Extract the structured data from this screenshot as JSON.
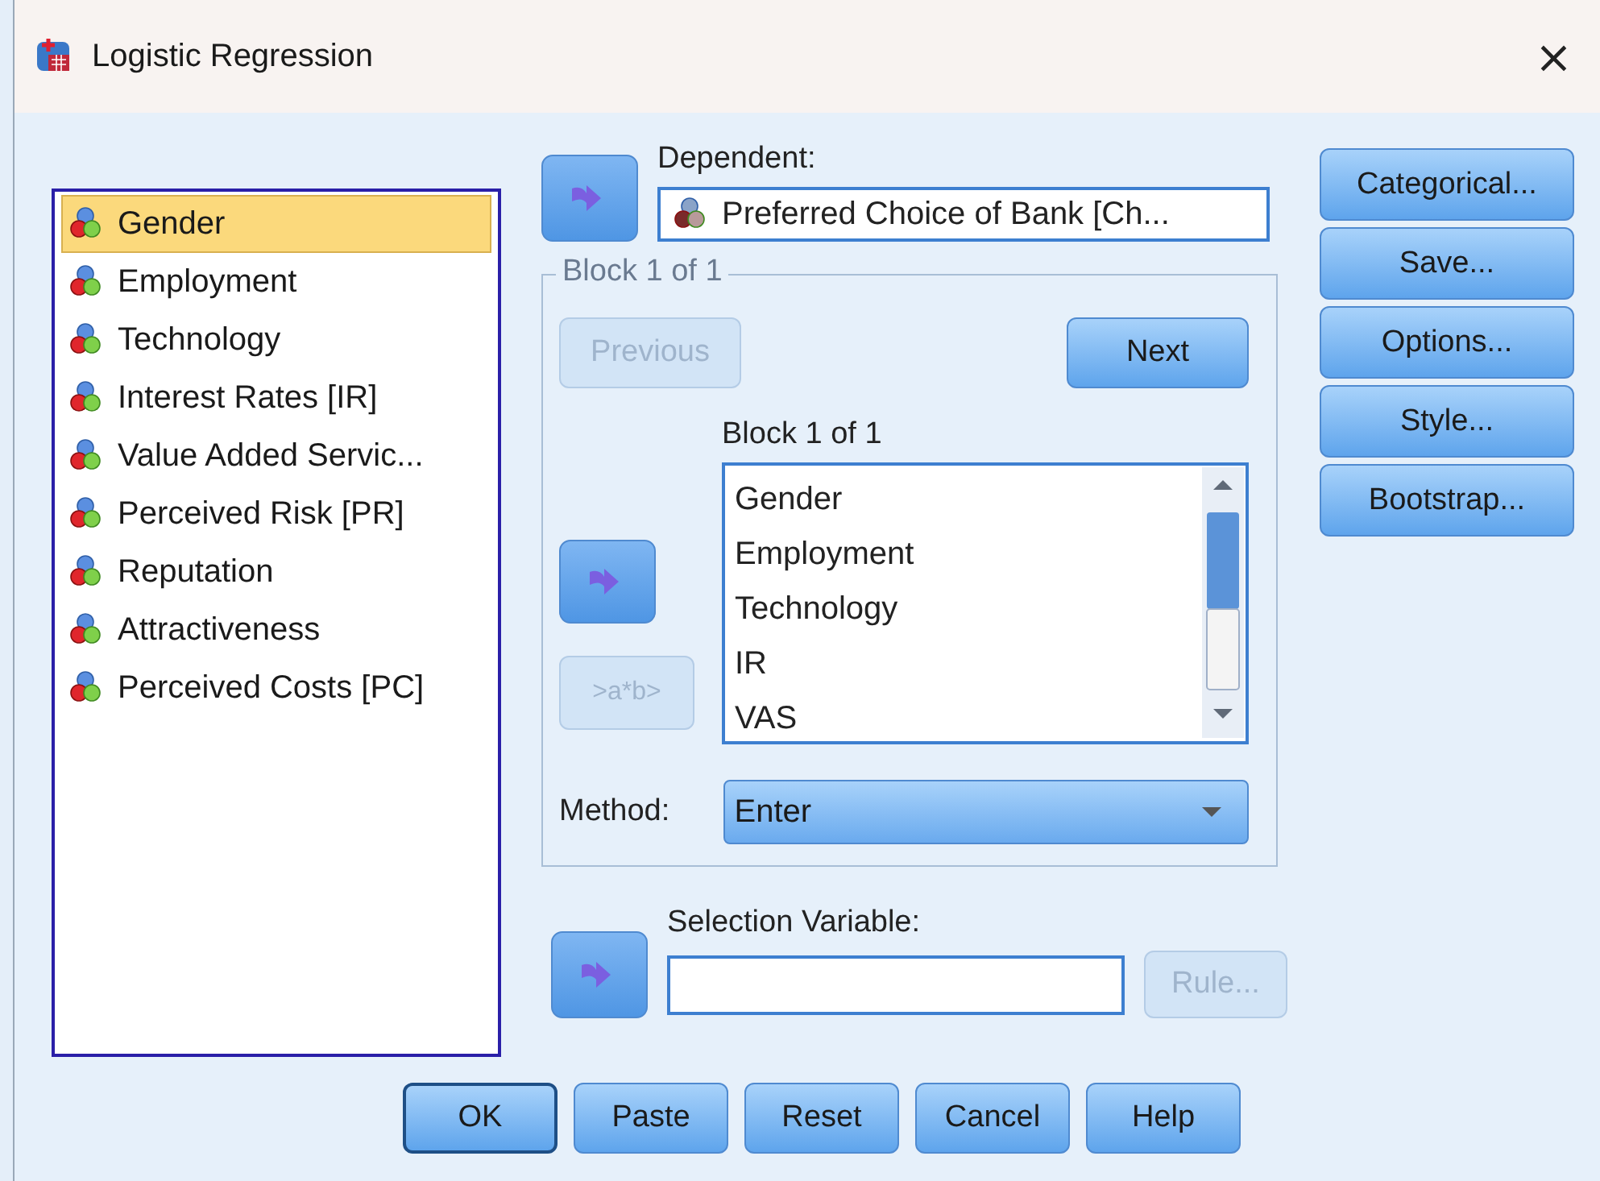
{
  "window": {
    "title": "Logistic Regression",
    "close": "×"
  },
  "variables": [
    {
      "name": "Gender",
      "selected": true
    },
    {
      "name": "Employment",
      "selected": false
    },
    {
      "name": "Technology",
      "selected": false
    },
    {
      "name": "Interest Rates [IR]",
      "selected": false
    },
    {
      "name": "Value Added Servic...",
      "selected": false
    },
    {
      "name": "Perceived Risk [PR]",
      "selected": false
    },
    {
      "name": "Reputation",
      "selected": false
    },
    {
      "name": "Attractiveness",
      "selected": false
    },
    {
      "name": "Perceived Costs [PC]",
      "selected": false
    }
  ],
  "dependent": {
    "label": "Dependent:",
    "value": "Preferred Choice of Bank [Ch..."
  },
  "block": {
    "legend": "Block 1 of 1",
    "previous": {
      "label": "Previous",
      "disabled": true
    },
    "next": {
      "label": "Next",
      "disabled": false
    },
    "list_label": "Block 1 of 1",
    "interaction": {
      "label": ">a*b>",
      "disabled": true
    },
    "covariates": [
      "Gender",
      "Employment",
      "Technology",
      "IR",
      "VAS"
    ],
    "method": {
      "label": "Method:",
      "value": "Enter"
    }
  },
  "selection": {
    "label": "Selection Variable:",
    "rule": {
      "label": "Rule...",
      "disabled": true
    }
  },
  "side_buttons": [
    {
      "label": "Categorical..."
    },
    {
      "label": "Save..."
    },
    {
      "label": "Options..."
    },
    {
      "label": "Style..."
    },
    {
      "label": "Bootstrap..."
    }
  ],
  "bottom_buttons": [
    {
      "label": "OK",
      "default": true
    },
    {
      "label": "Paste",
      "default": false
    },
    {
      "label": "Reset",
      "default": false
    },
    {
      "label": "Cancel",
      "default": false
    },
    {
      "label": "Help",
      "default": false
    }
  ]
}
